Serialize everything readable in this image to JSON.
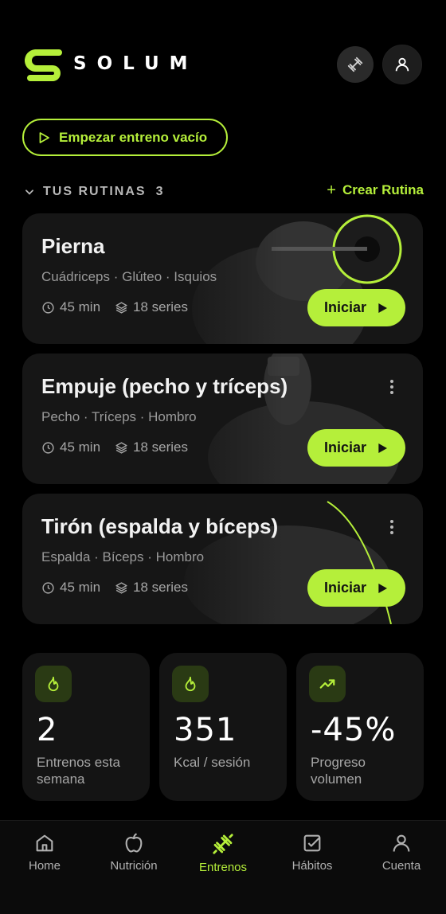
{
  "app": {
    "brand": "SOLUM"
  },
  "header": {
    "dumbbell_icon": "dumbbell-icon",
    "profile_icon": "user-icon"
  },
  "empty_workout": {
    "label": "Empezar entreno vacío"
  },
  "routines_section": {
    "title": "TUS RUTINAS",
    "count": "3",
    "create_label": "Crear Rutina"
  },
  "routines": [
    {
      "name": "Pierna",
      "muscles": "Cuádriceps · Glúteo · Isquios",
      "duration": "45 min",
      "series": "18 series",
      "start_label": "Iniciar"
    },
    {
      "name": "Empuje (pecho y tríceps)",
      "muscles": "Pecho · Tríceps · Hombro",
      "duration": "45 min",
      "series": "18 series",
      "start_label": "Iniciar"
    },
    {
      "name": "Tirón (espalda y bíceps)",
      "muscles": "Espalda · Bíceps · Hombro",
      "duration": "45 min",
      "series": "18 series",
      "start_label": "Iniciar"
    }
  ],
  "stats": [
    {
      "icon": "flame-icon",
      "value": "2",
      "label": "Entrenos esta semana"
    },
    {
      "icon": "flame-icon",
      "value": "351",
      "label": "Kcal / sesión"
    },
    {
      "icon": "trend-up-icon",
      "value": "-45%",
      "label": "Progreso volumen"
    }
  ],
  "nav": [
    {
      "label": "Home",
      "icon": "home-icon"
    },
    {
      "label": "Nutrición",
      "icon": "apple-icon"
    },
    {
      "label": "Entrenos",
      "icon": "dumbbell-icon",
      "active": true
    },
    {
      "label": "Hábitos",
      "icon": "checkbox-icon"
    },
    {
      "label": "Cuenta",
      "icon": "user-icon"
    }
  ],
  "colors": {
    "accent": "#b5ef3a",
    "background": "#000000",
    "card": "#161616"
  }
}
